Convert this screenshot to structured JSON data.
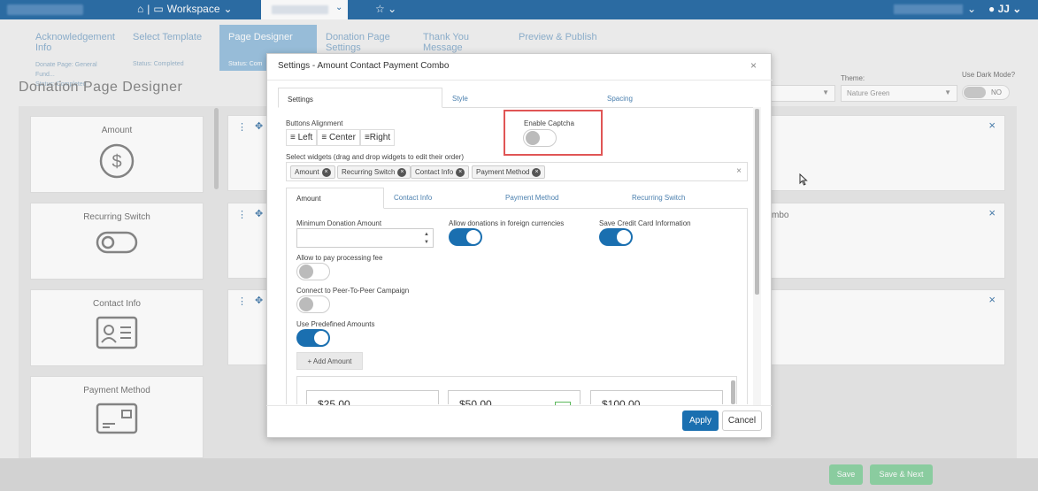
{
  "topbar": {
    "workspace_label": "Workspace",
    "user": "JJ"
  },
  "steps": [
    {
      "title": "Acknowledgement Info",
      "sub1": "Donate Page: General Fund...",
      "sub2": "Status: Completed"
    },
    {
      "title": "Select Template",
      "sub1": "",
      "sub2": "Status: Completed"
    },
    {
      "title": "Page Designer",
      "sub1": "",
      "sub2": "Status: Com"
    },
    {
      "title": "Donation Page Settings",
      "sub1": "",
      "sub2": ""
    },
    {
      "title": "Thank You Message",
      "sub1": "",
      "sub2": ""
    },
    {
      "title": "Preview & Publish",
      "sub1": "",
      "sub2": ""
    }
  ],
  "page": {
    "title": "Donation Page Designer",
    "theme_label": "Theme:",
    "theme_value": "Nature Green",
    "dark_label": "Use Dark Mode?",
    "dark_value": "NO"
  },
  "widgets_panel": [
    {
      "label": "Amount",
      "icon": "dollar-circle-icon"
    },
    {
      "label": "Recurring Switch",
      "icon": "toggle-icon"
    },
    {
      "label": "Contact Info",
      "icon": "contact-card-icon"
    },
    {
      "label": "Payment Method",
      "icon": "credit-card-icon"
    }
  ],
  "row2_text": "mbo",
  "dialog": {
    "title": "Settings - Amount Contact Payment Combo",
    "tabs": [
      "Settings",
      "Style",
      "Spacing"
    ],
    "buttons_alignment_label": "Buttons Alignment",
    "align": [
      "Left",
      "Center",
      "Right"
    ],
    "captcha_label": "Enable Captcha",
    "captcha_on": false,
    "select_widgets_label": "Select widgets (drag and drop widgets to edit their order)",
    "chips": [
      "Amount",
      "Recurring Switch",
      "Contact Info",
      "Payment Method"
    ],
    "subtabs": [
      "Amount",
      "Contact Info",
      "Payment Method",
      "Recurring Switch"
    ],
    "min_donation_label": "Minimum Donation Amount",
    "min_donation_value": "",
    "foreign_label": "Allow donations in foreign currencies",
    "foreign_on": true,
    "save_card_label": "Save Credit Card Information",
    "save_card_on": true,
    "processing_label": "Allow to pay processing fee",
    "processing_on": false,
    "p2p_label": "Connect to Peer-To-Peer Campaign",
    "p2p_on": false,
    "predefined_label": "Use Predefined Amounts",
    "predefined_on": true,
    "add_amount_label": "+ Add Amount",
    "amounts": [
      "$25.00",
      "$50.00",
      "$100.00"
    ],
    "apply_label": "Apply",
    "cancel_label": "Cancel"
  },
  "bottom": {
    "save_label": "Save",
    "save_next_label": "Save & Next"
  },
  "colors": {
    "primary": "#1a6fb0",
    "topbar": "#2d6fa8",
    "save_green": "#8fd3a5",
    "highlight": "#e05555"
  }
}
